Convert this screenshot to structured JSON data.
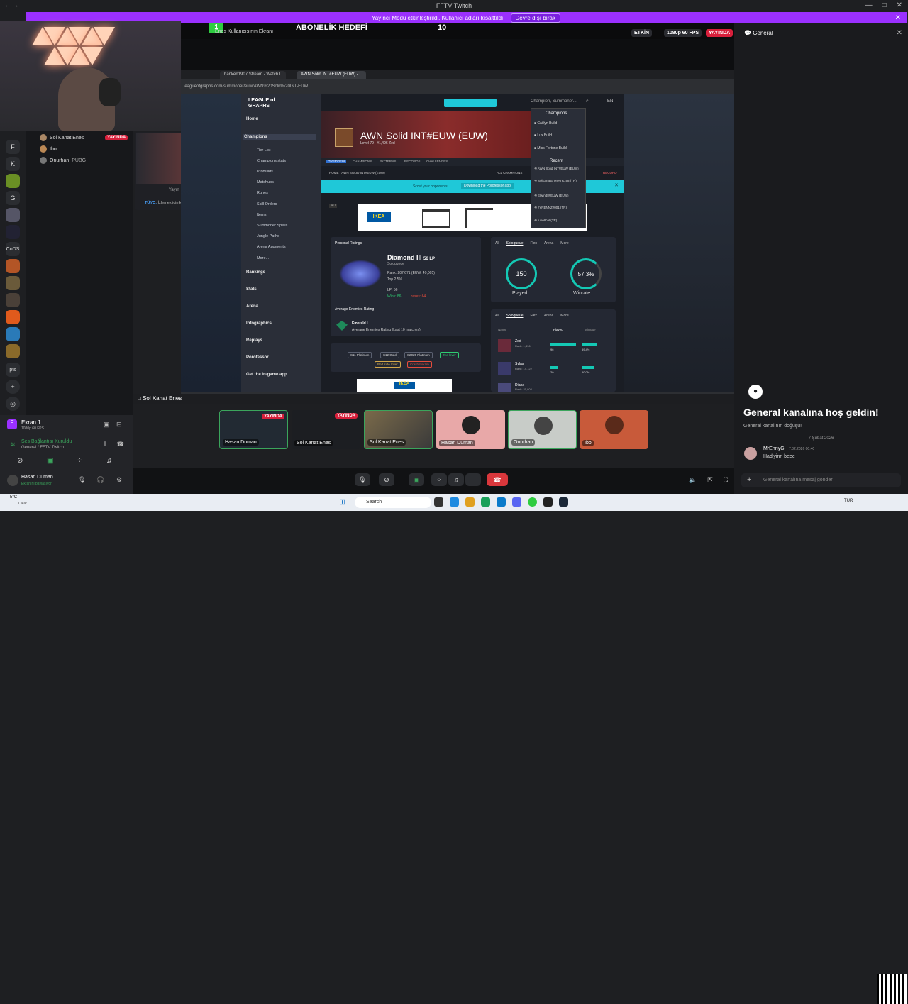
{
  "window": {
    "title": "FFTV Twitch",
    "controls": [
      "—",
      "□",
      "✕"
    ]
  },
  "notice": {
    "text": "Yayıncı Modu etkinleştirildi. Kullanıcı adları kısalttıldı.",
    "button": "Devre dışı bırak"
  },
  "rail": {
    "letters": [
      "F",
      "K",
      "G",
      "CoDS",
      "pts"
    ]
  },
  "stream": {
    "overlay_label": "Enes Kullanıcısının Ekranı",
    "overlay_count": "1",
    "goal_label": "ABONELİK HEDEFİ",
    "goal_value": "10",
    "chip_active": "ETKİN",
    "chip_quality": "1080p 60 FPS",
    "chip_live": "YAYINDA"
  },
  "browser": {
    "tabs": [
      "hanken1907 Stream - Watch L",
      "AWN Solid INT#EUW (EUW) - L"
    ],
    "url": "leagueofgraphs.com/summoner/euw/AWN%20Solid%20INT-EUW",
    "search_placeholder": "Champion, Summoner...",
    "lang": "EN"
  },
  "lol": {
    "logo": "LEAGUE of GRAPHS",
    "nav": [
      "Home",
      "Champions",
      "Rankings",
      "Stats",
      "Arena",
      "Infographics",
      "Replays",
      "Porofessor",
      "Get the in-game app"
    ],
    "subnav": [
      "Tier List",
      "Champions stats",
      "Probuilds",
      "Matchups",
      "Runes",
      "Skill Orders",
      "Items",
      "Summoner Spells",
      "Jungle Paths",
      "Arena Augments",
      "More..."
    ],
    "summoner": "AWN Solid INT#EUW (EUW)",
    "level": "Level 79 - #1,496 Zed",
    "tabs": [
      "OVERVIEW",
      "CHAMPIONS",
      "PATTERNS",
      "RECORDS",
      "CHALLENGES"
    ],
    "breadcrumb": "HOME › AWN SOLID INT#EUW (EUW)",
    "all_champs": "ALL CHAMPIONS",
    "record": "RECORD",
    "scout": "Scout your opponents",
    "download": "Download the Porofessor app",
    "personal_ratings": "Personal Ratings",
    "rank": "Diamond III",
    "lp": "56 LP",
    "queue": "Soloqueue",
    "rank_detail": "Rank: 207,671 (EUW: 49,005)",
    "top": "Top 2.5%",
    "lp_line": "LP: 56",
    "wins": "Wins: 86",
    "losses": "Losses: 64",
    "avg_enemies": "Average Enemies Rating",
    "emerald": "Emerald I",
    "emerald_sub": "Average Enemies Rating (Last 10 matches)",
    "tags": [
      "S11 Platinum",
      "S12 Gold",
      "S2025 Platinum",
      "Zed lover",
      "Red side lover",
      "Crash Itokam"
    ],
    "filters": [
      "All",
      "Soloqueue",
      "Flex",
      "Arena",
      "More"
    ],
    "played": "150",
    "played_label": "Played",
    "winrate": "57.3%",
    "winrate_label": "Winrate",
    "champ_header": [
      "Name",
      "Played",
      "Winrate"
    ],
    "champions": [
      {
        "name": "Zed",
        "rank": "Rank: 1,496",
        "played": "96",
        "winrate": "59.4%"
      },
      {
        "name": "Sylas",
        "rank": "Rank: 14,722",
        "played": "20",
        "winrate": "50.0%"
      },
      {
        "name": "Diana",
        "rank": "Rank: 21,802",
        "played": "",
        "winrate": ""
      }
    ],
    "dropdown_champions": "Champions",
    "dropdown_champ_items": [
      "Caitlyn Build",
      "Lux Build",
      "Miss Fortune Build"
    ],
    "dropdown_recent": "Recent",
    "dropdown_recent_items": [
      "AWN Solid INT#EUW (EUW)",
      "SolKanatEnes#TR198 (TR)",
      "Elwind8#EUW (EUW)",
      "zYRENNZ#001 (TR)",
      "tune#cel (TR)"
    ],
    "ad_brand": "IKEA"
  },
  "voice_users": [
    {
      "name": "Sol Kanat Enes",
      "live": "YAYINDA"
    },
    {
      "name": "Ibo",
      "extra": ""
    },
    {
      "name": "Onurhan",
      "extra": "PUBG"
    }
  ],
  "preview": {
    "watching": "Yayın İzliyor",
    "tip_label": "TÜYO:",
    "tip": "İzlemek için kullanıcıya çift tıkla"
  },
  "stream_owner": "Sol Kanat Enes",
  "tiles": [
    {
      "name": "Hasan Duman",
      "live": "YAYINDA"
    },
    {
      "name": "Sol Kanat Enes",
      "live": "YAYINDA"
    },
    {
      "name": "Sol Kanat Enes",
      "live": ""
    },
    {
      "name": "Hasan Duman",
      "live": ""
    },
    {
      "name": "Onurhan",
      "live": ""
    },
    {
      "name": "Ibo",
      "live": ""
    }
  ],
  "user_panel": {
    "screen": "Ekran 1",
    "screen_sub": "1080p 60 FPS",
    "voice_status": "Ses Bağlantısı Kuruldu",
    "voice_channel": "General / FFTV Twitch",
    "username": "Hasan Duman",
    "user_status": "Ekranını paylaşıyor"
  },
  "right": {
    "channel": "General",
    "welcome": "General kanalına hoş geldin!",
    "welcome_sub": "General kanalının doğuşu!",
    "date_divider": "7 Şubat 2026",
    "message_author": "MrEnnyG",
    "message_time": "7.02.2026 00:40",
    "message_text": "Hadiyinn beee",
    "input_placeholder": "General kanalına mesaj gönder"
  },
  "taskbar": {
    "weather": "5°C",
    "weather_sub": "Clear",
    "search": "Search",
    "lang": "TUR"
  },
  "colors": {
    "accent": "#9b30ff",
    "live": "#d71f3b",
    "cyan": "#1fc8d8",
    "teal": "#14c8b4"
  }
}
